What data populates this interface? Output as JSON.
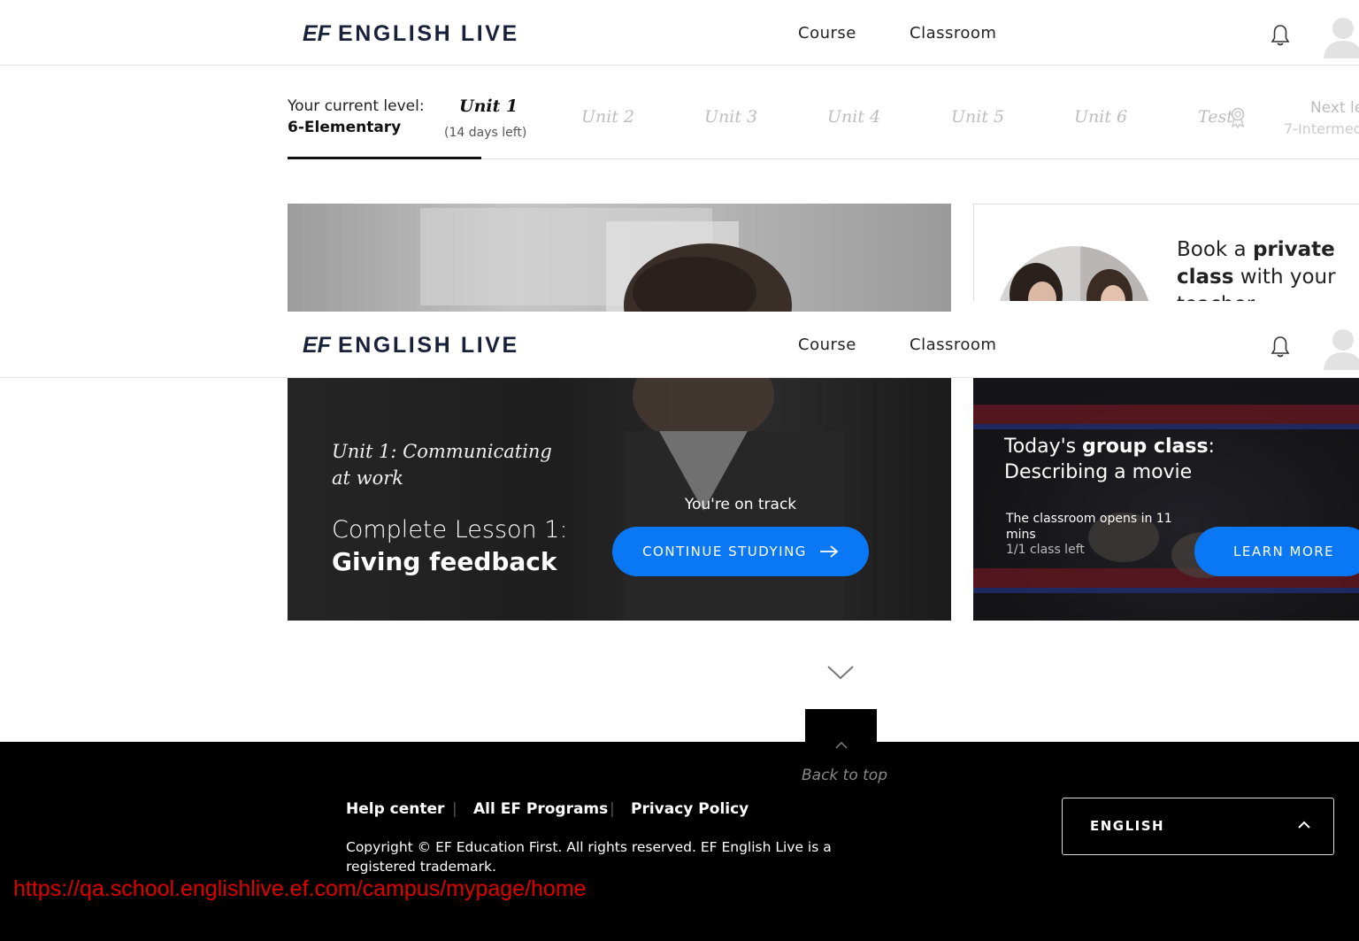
{
  "header": {
    "logo_mark": "EF",
    "logo_text": "ENGLISH LIVE",
    "nav": [
      {
        "label": "Course"
      },
      {
        "label": "Classroom"
      }
    ]
  },
  "level": {
    "label": "Your current level:",
    "value": "6-Elementary",
    "units": [
      {
        "label": "Unit 1",
        "current": true
      },
      {
        "label": "Unit 2"
      },
      {
        "label": "Unit 3"
      },
      {
        "label": "Unit 4"
      },
      {
        "label": "Unit 5"
      },
      {
        "label": "Unit 6"
      },
      {
        "label": "Test"
      }
    ],
    "days_left": "(14 days left)",
    "next_label": "Next le",
    "next_value": "7-Intermed"
  },
  "hero": {
    "unit_title": "Unit 1: Communicating at work",
    "lesson_prefix": "Complete Lesson 1:",
    "lesson_name": "Giving feedback",
    "status": "You're on track",
    "cta": "CONTINUE STUDYING"
  },
  "private_class": {
    "text_prefix": "Book a ",
    "text_bold1": "private",
    "text_bold2": "class",
    "text_suffix": " with your teacher"
  },
  "group_class": {
    "title_prefix": "Today's ",
    "title_bold": "group class",
    "title_colon": ":",
    "topic": "Describing a movie",
    "opens": "The classroom opens in 11 mins",
    "left": "1/1 class left",
    "cta": "LEARN MORE"
  },
  "footer": {
    "back_to_top": "Back to top",
    "links": [
      {
        "label": "Help center"
      },
      {
        "label": "All EF Programs"
      },
      {
        "label": "Privacy Policy"
      }
    ],
    "separator": "|",
    "copyright": "Copyright © EF Education First. All rights reserved. EF English Live is a registered trademark.",
    "language": "ENGLISH"
  },
  "overlay_url": "https://qa.school.englishlive.ef.com/campus/mypage/home",
  "colors": {
    "accent": "#0a78f5",
    "footer_bg": "#000000",
    "logo": "#17223a",
    "url_overlay": "#e00000"
  },
  "icons": {
    "bell": "bell-icon",
    "avatar": "user-avatar",
    "arrow": "arrow-right-icon",
    "award": "award-ribbon-icon"
  }
}
